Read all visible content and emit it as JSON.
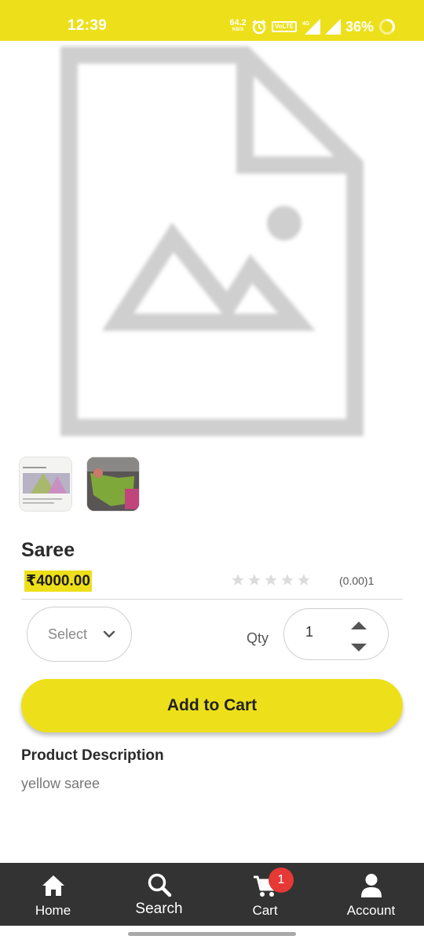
{
  "status_bar": {
    "time": "12:39",
    "net_speed_value": "64.2",
    "net_speed_unit": "KB/S",
    "volte": "VoLTE",
    "network_type": "4G",
    "battery": "36%",
    "background_color": "#ede01a"
  },
  "product": {
    "main_image_icon": "image-placeholder-icon",
    "thumbnails": [
      "saree-thumbnail-1",
      "saree-thumbnail-2"
    ],
    "title": "Saree",
    "price": "₹4000.00",
    "rating_stars_filled": 0,
    "rating_stars_total": 5,
    "rating_text": "(0.00)1"
  },
  "options": {
    "select_label": "Select",
    "qty_label": "Qty",
    "qty_value": "1"
  },
  "actions": {
    "add_to_cart": "Add to Cart"
  },
  "description": {
    "title": "Product Description",
    "text": "yellow saree"
  },
  "bottom_nav": {
    "items": [
      {
        "label": "Home",
        "icon": "home-icon"
      },
      {
        "label": "Search",
        "icon": "search-icon"
      },
      {
        "label": "Cart",
        "icon": "cart-icon"
      },
      {
        "label": "Account",
        "icon": "account-icon"
      }
    ],
    "cart_badge": "1"
  },
  "colors": {
    "accent": "#ede01a",
    "nav_background": "#333333",
    "badge": "#e53935"
  }
}
